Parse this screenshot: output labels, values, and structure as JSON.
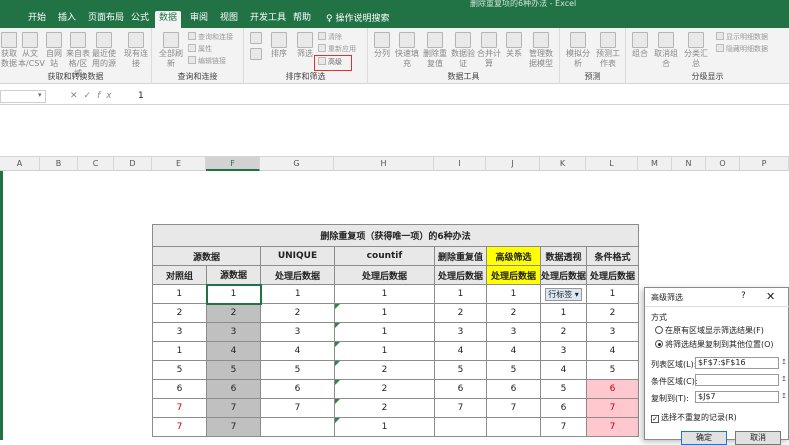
{
  "window": {
    "title": "删除重复项的6种办法 - Excel"
  },
  "ribbon_tabs": [
    "开始",
    "插入",
    "页面布局",
    "公式",
    "数据",
    "审阅",
    "视图",
    "开发工具",
    "帮助"
  ],
  "tell_me": "操作说明搜索",
  "groups": {
    "get_data": {
      "label": "获取和转换数据",
      "buttons": [
        "获取数据",
        "从文本/CSV",
        "自网站",
        "来自表格/区域",
        "最近使用的源",
        "现有连接"
      ]
    },
    "queries": {
      "label": "查询和连接",
      "main": "全部刷新",
      "items": [
        "查询和连接",
        "属性",
        "编辑链接"
      ]
    },
    "sort_filter": {
      "label": "排序和筛选",
      "sort": "排序",
      "filter": "筛选",
      "items": [
        "清除",
        "重新应用",
        "高级"
      ]
    },
    "data_tools": {
      "label": "数据工具",
      "buttons": [
        "分列",
        "快速填充",
        "删除重复值",
        "数据验证",
        "合并计算",
        "关系",
        "管理数据模型"
      ]
    },
    "forecast": {
      "label": "预测",
      "buttons": [
        "模拟分析",
        "预测工作表"
      ]
    },
    "outline": {
      "label": "分级显示",
      "buttons": [
        "组合",
        "取消组合",
        "分类汇总"
      ],
      "items": [
        "显示明细数据",
        "隐藏明细数据"
      ]
    }
  },
  "formula_bar": {
    "name_box": "",
    "value": "1"
  },
  "columns": [
    "A",
    "B",
    "C",
    "D",
    "E",
    "F",
    "G",
    "H",
    "I",
    "J",
    "K",
    "L",
    "M",
    "N",
    "O",
    "P"
  ],
  "table": {
    "title": "删除重复项（获得唯一项）的6种办法",
    "group_header": {
      "source": "源数据",
      "unique": "UNIQUE",
      "countif": "countif",
      "remove_dup": "删除重复值",
      "adv_filter": "高级筛选",
      "pivot": "数据透视",
      "cond_format": "条件格式"
    },
    "sub_header": {
      "compare": "对照组",
      "source": "源数据",
      "processed": "处理后数据"
    },
    "pivot_label": "行标签",
    "rows": [
      [
        "1",
        "1",
        "1",
        "1",
        "1",
        "1",
        "",
        "1"
      ],
      [
        "2",
        "2",
        "2",
        "1",
        "2",
        "2",
        "1",
        "2"
      ],
      [
        "3",
        "3",
        "3",
        "1",
        "3",
        "3",
        "2",
        "3"
      ],
      [
        "1",
        "4",
        "4",
        "1",
        "4",
        "4",
        "3",
        "4"
      ],
      [
        "5",
        "5",
        "5",
        "2",
        "5",
        "5",
        "4",
        "5"
      ],
      [
        "6",
        "6",
        "6",
        "2",
        "6",
        "6",
        "5",
        "6"
      ],
      [
        "7",
        "7",
        "7",
        "2",
        "7",
        "7",
        "6",
        "7"
      ],
      [
        "7",
        "7",
        "",
        "1",
        "",
        "",
        "7",
        "7"
      ]
    ]
  },
  "dialog": {
    "title": "高级筛选",
    "help": "?",
    "close": "✕",
    "mode_label": "方式",
    "option1": "在原有区域显示筛选结果(F)",
    "option2": "将筛选结果复制到其他位置(O)",
    "list_range_label": "列表区域(L):",
    "list_range": "$F$7:$F$16",
    "criteria_label": "条件区域(C):",
    "criteria": "",
    "copy_to_label": "复制到(T):",
    "copy_to": "$J$7",
    "unique_label": "选择不重复的记录(R)",
    "ok": "确定",
    "cancel": "取消"
  }
}
